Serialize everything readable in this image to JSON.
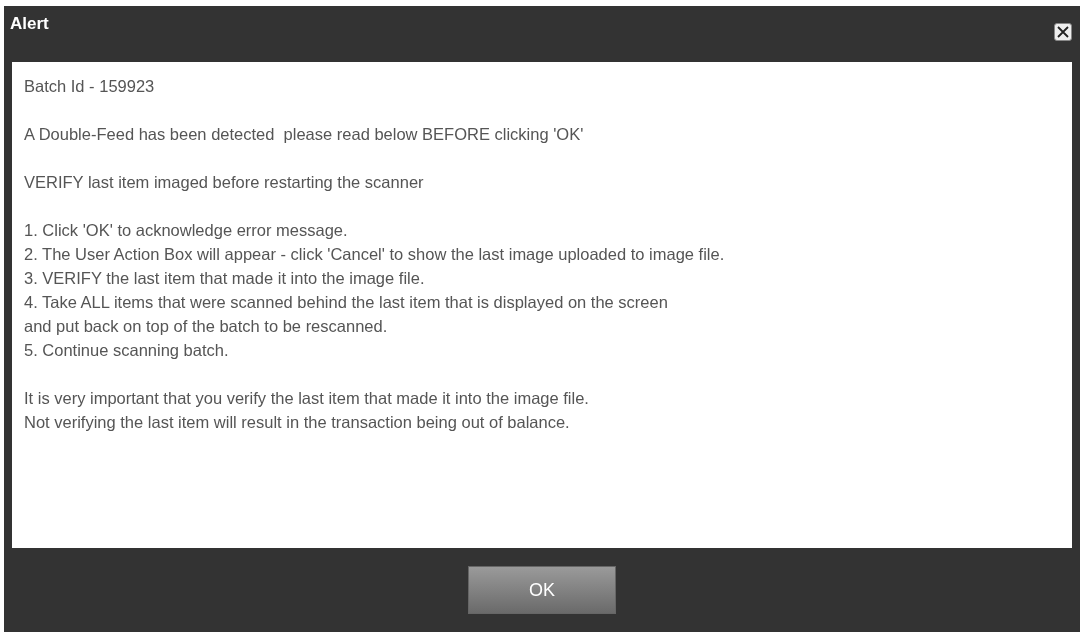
{
  "dialog": {
    "title": "Alert",
    "paragraphs": [
      {
        "lines": [
          "Batch Id - 159923"
        ]
      },
      {
        "lines": [
          "A Double-Feed has been detected  please read below BEFORE clicking 'OK'"
        ]
      },
      {
        "lines": [
          "VERIFY last item imaged before restarting the scanner"
        ]
      },
      {
        "lines": [
          "1. Click 'OK' to acknowledge error message.",
          "2. The User Action Box will appear - click 'Cancel' to show the last image uploaded to image file.",
          "3. VERIFY the last item that made it into the image file.",
          "4. Take ALL items that were scanned behind the last item that is displayed on the screen",
          "and put back on top of the batch to be rescanned.",
          "5. Continue scanning batch."
        ]
      },
      {
        "lines": [
          "It is very important that you verify the last item that made it into the image file.",
          "Not verifying the last item will result in the transaction being out of balance."
        ]
      }
    ],
    "buttons": [
      "OK"
    ]
  }
}
